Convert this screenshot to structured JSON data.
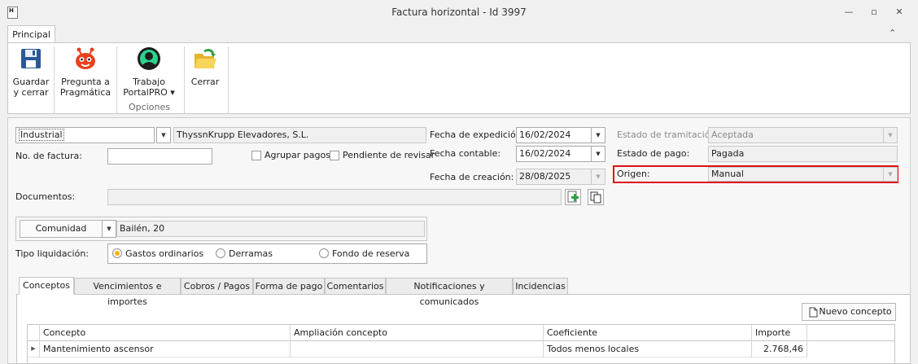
{
  "window": {
    "title": "Factura horizontal - Id 3997",
    "minimize": "—",
    "maximize": "▫",
    "close": "✕"
  },
  "ribbon": {
    "tab": "Principal",
    "buttons": {
      "save_line1": "Guardar",
      "save_line2": "y cerrar",
      "ask_line1": "Pregunta a",
      "ask_line2": "Pragmática",
      "work_line1": "Trabajo",
      "work_line2": "PortalPRO ▾",
      "close": "Cerrar"
    },
    "group_label": "Opciones"
  },
  "form": {
    "tipo_proveedor": "Industrial",
    "proveedor": "ThyssnKrupp Elevadores, S.L.",
    "no_factura_label": "No. de factura:",
    "no_factura_value": "",
    "agrupar_pagos": "Agrupar pagos",
    "pendiente_revisar": "Pendiente de revisar",
    "fecha_expedicion_label": "Fecha de expedición:",
    "fecha_expedicion": "16/02/2024",
    "fecha_contable_label": "Fecha contable:",
    "fecha_contable": "16/02/2024",
    "fecha_creacion_label": "Fecha de creación:",
    "fecha_creacion": "28/08/2025",
    "estado_tramitacion_label": "Estado de tramitación:",
    "estado_tramitacion": "Aceptada",
    "estado_pago_label": "Estado de pago:",
    "estado_pago": "Pagada",
    "origen_label": "Origen:",
    "origen": "Manual",
    "documentos_label": "Documentos:",
    "documentos_value": "",
    "comunidad_btn": "Comunidad",
    "comunidad_value": "Bailén, 20",
    "tipo_liquidacion_label": "Tipo liquidación:",
    "liquidacion_options": [
      "Gastos ordinarios",
      "Derramas",
      "Fondo de reserva"
    ]
  },
  "tabs": [
    "Conceptos",
    "Vencimientos e importes",
    "Cobros / Pagos",
    "Forma de pago",
    "Comentarios",
    "Notificaciones y comunicados",
    "Incidencias"
  ],
  "conceptos": {
    "new_button": "Nuevo concepto",
    "columns": [
      "Concepto",
      "Ampliación concepto",
      "Coeficiente",
      "Importe"
    ],
    "rows": [
      {
        "concepto": "Mantenimiento ascensor",
        "ampliacion": "",
        "coeficiente": "Todos menos locales",
        "importe": "2.768,46"
      }
    ]
  }
}
